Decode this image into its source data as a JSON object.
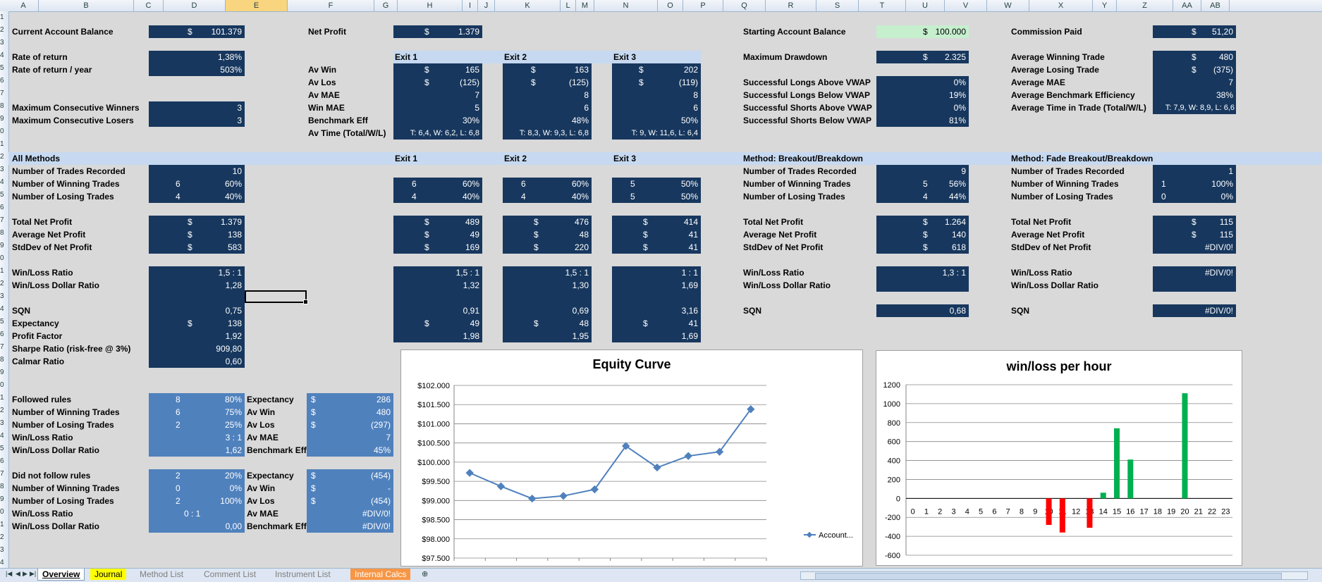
{
  "columns": [
    "A",
    "B",
    "C",
    "D",
    "E",
    "F",
    "G",
    "H",
    "I",
    "J",
    "K",
    "L",
    "M",
    "N",
    "O",
    "P",
    "Q",
    "R",
    "S",
    "T",
    "U",
    "V",
    "W",
    "X",
    "Y",
    "Z",
    "AA",
    "AB"
  ],
  "rows": [
    "1",
    "2",
    "3",
    "4",
    "5",
    "6",
    "7",
    "8",
    "9",
    "0",
    "1",
    "2",
    "3",
    "4",
    "5",
    "6",
    "7",
    "8",
    "9",
    "0",
    "1",
    "2",
    "3",
    "4",
    "5",
    "6",
    "7",
    "8",
    "9",
    "0",
    "1",
    "2",
    "3",
    "4",
    "5",
    "6",
    "7",
    "8",
    "9",
    "0",
    "1",
    "2",
    "3",
    "4"
  ],
  "summary": {
    "current_balance_label": "Current Account Balance",
    "current_balance": "101.379",
    "rate_return_label": "Rate of return",
    "rate_return": "1,38%",
    "rate_return_year_label": "Rate of return / year",
    "rate_return_year": "503%",
    "max_winners_label": "Maximum Consecutive Winners",
    "max_winners": "3",
    "max_losers_label": "Maximum Consecutive Losers",
    "max_losers": "3",
    "net_profit_label": "Net Profit",
    "net_profit": "1.379",
    "av_win_label": "Av Win",
    "av_los_label": "Av Los",
    "av_mae_label": "Av MAE",
    "win_mae_label": "Win MAE",
    "bench_label": "Benchmark Eff",
    "av_time_label": "Av Time  (Total/W/L)",
    "starting_balance_label": "Starting Account Balance",
    "starting_balance": "100.000",
    "max_drawdown_label": "Maximum Drawdown",
    "max_drawdown": "2.325",
    "long_above_label": "Successful Longs Above VWAP",
    "long_above": "0%",
    "long_below_label": "Successful Longs Below VWAP",
    "long_below": "19%",
    "short_above_label": "Successful Shorts Above VWAP",
    "short_above": "0%",
    "short_below_label": "Successful Shorts Below VWAP",
    "short_below": "81%",
    "commission_label": "Commission Paid",
    "commission": "51,20",
    "avg_win_trade_label": "Average Winning Trade",
    "avg_win_trade": "480",
    "avg_lose_trade_label": "Average Losing Trade",
    "avg_lose_trade": "(375)",
    "avg_mae_label": "Average MAE",
    "avg_mae": "7",
    "avg_bench_label": "Average Benchmark Efficiency",
    "avg_bench": "38%",
    "avg_time_label": "Average Time in Trade (Total/W/L)",
    "avg_time": "T: 7,9, W: 8,9, L: 6,6",
    "dollar": "$"
  },
  "exits_top": [
    {
      "name": "Exit 1",
      "av_win": "165",
      "av_los": "(125)",
      "av_mae": "7",
      "win_mae": "5",
      "bench": "30%",
      "time": "T: 6,4, W: 6,2, L: 6,8"
    },
    {
      "name": "Exit 2",
      "av_win": "163",
      "av_los": "(125)",
      "av_mae": "8",
      "win_mae": "6",
      "bench": "48%",
      "time": "T: 8,3, W: 9,3, L: 6,8"
    },
    {
      "name": "Exit 3",
      "av_win": "202",
      "av_los": "(119)",
      "av_mae": "8",
      "win_mae": "6",
      "bench": "50%",
      "time": "T: 9, W: 11,6, L: 6,4"
    }
  ],
  "methods": {
    "all_label": "All Methods",
    "trades_label": "Number of Trades Recorded",
    "win_trades_label": "Number of Winning Trades",
    "lose_trades_label": "Number of Losing Trades",
    "total_np_label": "Total Net Profit",
    "avg_np_label": "Average Net Profit",
    "std_np_label": "StdDev of Net Profit",
    "wl_ratio_label": "Win/Loss Ratio",
    "wl_dollar_label": "Win/Loss Dollar Ratio",
    "sqn_label": "SQN",
    "expectancy_label": "Expectancy",
    "profit_factor_label": "Profit Factor",
    "sharpe_label": "Sharpe Ratio (risk-free @ 3%)",
    "calmar_label": "Calmar Ratio",
    "all": {
      "trades": "10",
      "win_n": "6",
      "win_p": "60%",
      "lose_n": "4",
      "lose_p": "40%",
      "total": "1.379",
      "avg": "138",
      "std": "583",
      "wl": "1,5 : 1",
      "wld": "1,28",
      "sqn": "0,75",
      "exp": "138",
      "pf": "1,92",
      "sharpe": "909,80",
      "calmar": "0,60"
    },
    "exits": [
      {
        "name": "Exit 1",
        "win_n": "6",
        "win_p": "60%",
        "lose_n": "4",
        "lose_p": "40%",
        "total": "489",
        "avg": "49",
        "std": "169",
        "wl": "1,5 : 1",
        "wld": "1,32",
        "sqn": "0,91",
        "exp": "49",
        "pf": "1,98"
      },
      {
        "name": "Exit 2",
        "win_n": "6",
        "win_p": "60%",
        "lose_n": "4",
        "lose_p": "40%",
        "total": "476",
        "avg": "48",
        "std": "220",
        "wl": "1,5 : 1",
        "wld": "1,30",
        "sqn": "0,69",
        "exp": "48",
        "pf": "1,95"
      },
      {
        "name": "Exit 3",
        "win_n": "5",
        "win_p": "50%",
        "lose_n": "5",
        "lose_p": "50%",
        "total": "414",
        "avg": "41",
        "std": "41",
        "wl": "1 : 1",
        "wld": "1,69",
        "sqn": "3,16",
        "exp": "41",
        "pf": "1,69"
      }
    ],
    "breakout": {
      "name": "Method: Breakout/Breakdown",
      "trades": "9",
      "win_n": "5",
      "win_p": "56%",
      "lose_n": "4",
      "lose_p": "44%",
      "total": "1.264",
      "avg": "140",
      "std": "618",
      "wl": "1,3 : 1",
      "wld": "",
      "sqn": "0,68"
    },
    "fade": {
      "name": "Method: Fade Breakout/Breakdown",
      "trades": "1",
      "win_n": "1",
      "win_p": "100%",
      "lose_n": "0",
      "lose_p": "0%",
      "total": "115",
      "avg": "115",
      "std": "#DIV/0!",
      "wl": "#DIV/0!",
      "wld": "",
      "sqn": "#DIV/0!"
    }
  },
  "rules": {
    "followed_label": "Followed rules",
    "followed_n": "8",
    "followed_p": "80%",
    "f_win_n": "6",
    "f_win_p": "75%",
    "f_lose_n": "2",
    "f_lose_p": "25%",
    "f_wl": "3 : 1",
    "f_wld": "1,62",
    "f_exp": "286",
    "f_avwin": "480",
    "f_avlos": "(297)",
    "f_avmae": "7",
    "f_bench": "45%",
    "notfollowed_label": "Did not follow rules",
    "nf_n": "2",
    "nf_p": "20%",
    "nf_win_n": "0",
    "nf_win_p": "0%",
    "nf_lose_n": "2",
    "nf_lose_p": "100%",
    "nf_wl": "0 : 1",
    "nf_wld": "0,00",
    "nf_exp": "(454)",
    "nf_avwin": "-",
    "nf_avlos": "(454)",
    "nf_avmae": "#DIV/0!",
    "nf_bench": "#DIV/0!",
    "av_mae_label": "Av MAE"
  },
  "chart_data": [
    {
      "type": "line",
      "title": "Equity Curve",
      "series": [
        {
          "name": "Account...",
          "values": [
            99720,
            99370,
            99050,
            99120,
            99290,
            100420,
            99860,
            100160,
            100270,
            101379
          ]
        }
      ],
      "ylim": [
        97500,
        102000
      ],
      "yticks": [
        "$97.500",
        "$98.000",
        "$98.500",
        "$99.000",
        "$99.500",
        "$100.000",
        "$100.500",
        "$101.000",
        "$101.500",
        "$102.000"
      ],
      "color": "#4f81bd"
    },
    {
      "type": "bar",
      "title": "win/loss per hour",
      "categories": [
        "0",
        "1",
        "2",
        "3",
        "4",
        "5",
        "6",
        "7",
        "8",
        "9",
        "10",
        "11",
        "12",
        "13",
        "14",
        "15",
        "16",
        "17",
        "18",
        "19",
        "20",
        "21",
        "22",
        "23"
      ],
      "values": [
        0,
        0,
        0,
        0,
        0,
        0,
        0,
        0,
        0,
        0,
        -280,
        -360,
        0,
        -310,
        60,
        740,
        410,
        0,
        0,
        0,
        1110,
        0,
        0,
        0
      ],
      "ylim": [
        -600,
        1200
      ],
      "yticks": [
        "-600",
        "-400",
        "-200",
        "0",
        "200",
        "400",
        "600",
        "800",
        "1000",
        "1200"
      ],
      "pos_color": "#00b050",
      "neg_color": "#ff0000"
    }
  ],
  "tabs": [
    {
      "label": "Overview"
    },
    {
      "label": "Journal"
    },
    {
      "label": "Method List"
    },
    {
      "label": "Comment List"
    },
    {
      "label": "Instrument List"
    },
    {
      "label": "Internal Calcs"
    }
  ]
}
